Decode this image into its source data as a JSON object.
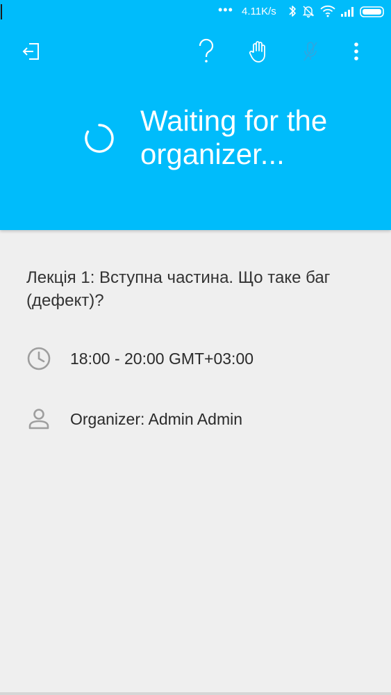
{
  "status_bar": {
    "dots": "•••",
    "network_speed": "4.11K/s",
    "icons": [
      "bluetooth-icon",
      "alarm-off-icon",
      "wifi-icon",
      "signal-icon",
      "battery-icon"
    ]
  },
  "toolbar": {
    "icons": [
      "exit-icon",
      "help-icon",
      "raise-hand-icon",
      "mic-off-icon",
      "more-vert-icon"
    ]
  },
  "header": {
    "waiting_text": "Waiting for the organizer...",
    "background_color": "#00bcfb"
  },
  "event": {
    "title": "Лекція 1: Вступна частина. Що таке баг (дефект)?",
    "time": "18:00 - 20:00 GMT+03:00",
    "organizer": "Organizer: Admin Admin"
  }
}
